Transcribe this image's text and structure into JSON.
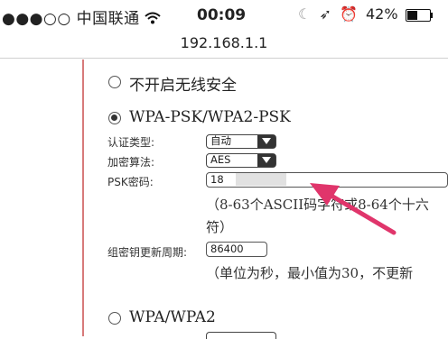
{
  "status_bar": {
    "signal": "●●●○○",
    "carrier": "中国联通",
    "wifi_icon": "wifi-icon",
    "time": "00:09",
    "moon": "☾",
    "location": "➶",
    "alarm": "⏰",
    "battery": "42%"
  },
  "address_bar": {
    "url": "192.168.1.1"
  },
  "options": {
    "no_security": "不开启无线安全",
    "wpa_psk": "WPA-PSK/WPA2-PSK",
    "wpa": "WPA/WPA2"
  },
  "form": {
    "auth_type_label": "认证类型:",
    "auth_type_value": "自动",
    "encryption_label": "加密算法:",
    "encryption_value": "AES",
    "psk_label": "PSK密码:",
    "psk_value": "18",
    "psk_hint_line1": "（8-63个ASCII码字符或8-64个十六",
    "psk_hint_line2": "符）",
    "group_key_label": "组密钥更新周期:",
    "group_key_value": "86400",
    "group_key_hint": "（单位为秒，最小值为30，不更新"
  },
  "colors": {
    "arrow": "#e0356b",
    "rule": "#d77a7a"
  }
}
